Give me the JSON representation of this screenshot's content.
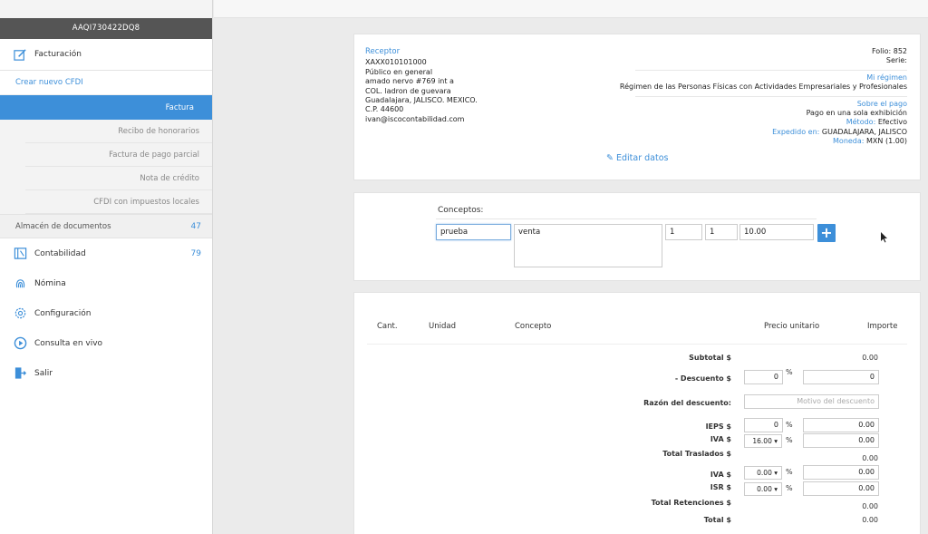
{
  "sidebar": {
    "rfc": "AAQI730422DQ8",
    "facturacion": "Facturación",
    "crear": "Crear nuevo CFDI",
    "sub_items": [
      "Factura",
      "Recibo de honorarios",
      "Factura de pago parcial",
      "Nota de crédito",
      "CFDI con impuestos locales"
    ],
    "almacen": "Almacén de documentos",
    "almacen_count": "47",
    "contabilidad": "Contabilidad",
    "contabilidad_count": "79",
    "nomina": "Nómina",
    "configuracion": "Configuración",
    "consulta": "Consulta en vivo",
    "salir": "Salir"
  },
  "receptor": {
    "label": "Receptor",
    "lines": [
      "XAXX010101000",
      "Público en general",
      "amado nervo #769 int a",
      "COL. ladron de guevara",
      "Guadalajara, JALISCO. MEXICO.",
      "C.P. 44600",
      "ivan@iscocontabilidad.com"
    ]
  },
  "emisor": {
    "folio": "Folio: 852",
    "serie": "Serie:",
    "mi_regimen": "Mi régimen",
    "regimen": "Régimen de las Personas Físicas con Actividades Empresariales y Profesionales",
    "sobre_pago": "Sobre el pago",
    "pago": "Pago en una sola exhibición",
    "metodo_lbl": "Método:",
    "metodo_val": "Efectivo",
    "expedido_lbl": "Expedido en:",
    "expedido_val": "GUADALAJARA, JALISCO",
    "moneda_lbl": "Moneda:",
    "moneda_val": "MXN (1.00)",
    "editar": "Editar datos"
  },
  "conceptos": {
    "label": "Conceptos:",
    "clave": "prueba",
    "descripcion": "venta",
    "cantidad": "1",
    "unidad": "1",
    "precio": "10.00",
    "add": "+"
  },
  "tabla": {
    "headers": [
      "Cant.",
      "Unidad",
      "Concepto",
      "Precio unitario",
      "Importe"
    ]
  },
  "totales": {
    "subtotal_lbl": "Subtotal $",
    "subtotal_val": "0.00",
    "descuento_lbl": "- Descuento $",
    "descuento_pct": "0",
    "descuento_val": "0",
    "razon_lbl": "Razón del descuento:",
    "razon_placeholder": "Motivo del descuento",
    "ieps_lbl": "IEPS $",
    "ieps_pct": "0",
    "ieps_val": "0.00",
    "iva_lbl": "IVA $",
    "iva_sel": "16.00 ▾",
    "iva_val": "0.00",
    "traslados_lbl": "Total Traslados $",
    "traslados_val": "0.00",
    "ret_iva_lbl": "IVA $",
    "ret_iva_sel": "0.00 ▾",
    "ret_iva_val": "0.00",
    "isr_lbl": "ISR $",
    "isr_sel": "0.00 ▾",
    "isr_val": "0.00",
    "retenciones_lbl": "Total Retenciones $",
    "retenciones_val": "0.00",
    "total_lbl": "Total $",
    "total_val": "0.00",
    "pct": "%"
  }
}
